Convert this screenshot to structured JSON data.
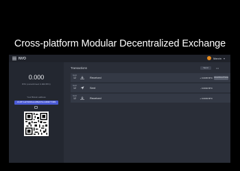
{
  "headline": "Cross-platform Modular Decentralized Exchange",
  "topbar": {
    "brand": "NVO",
    "username": "Marcin",
    "avatar_color": "#e88a1a"
  },
  "wallet": {
    "balance": "0.000",
    "balance_sub": "BTC (unconfirmed: 0.000 BTC)",
    "address_label": "Your Bitcoin address",
    "address": "1JL2BYLeEYM6b6HuAMBqbFNLuGM3ET7VMM"
  },
  "transactions": {
    "title": "Transactions",
    "filter_label": "Send",
    "more_label": "•••",
    "items": [
      {
        "month": "MAR",
        "day": "12",
        "type": "Received",
        "icon": "received-icon",
        "amount": "+ 0.0005 BTC",
        "badge": "Unconfirmed Transaction"
      },
      {
        "month": "MAR",
        "day": "12",
        "type": "Sent",
        "icon": "sent-icon",
        "amount": "- 0.0002 BTC",
        "badge": ""
      },
      {
        "month": "MAR",
        "day": "12",
        "type": "Received",
        "icon": "received-icon",
        "amount": "+ 0.0003 BTC",
        "badge": ""
      }
    ]
  },
  "colors": {
    "accent": "#4b5bd6",
    "panel": "#2a2e38",
    "sidebar": "#232730",
    "row": "#343945"
  }
}
